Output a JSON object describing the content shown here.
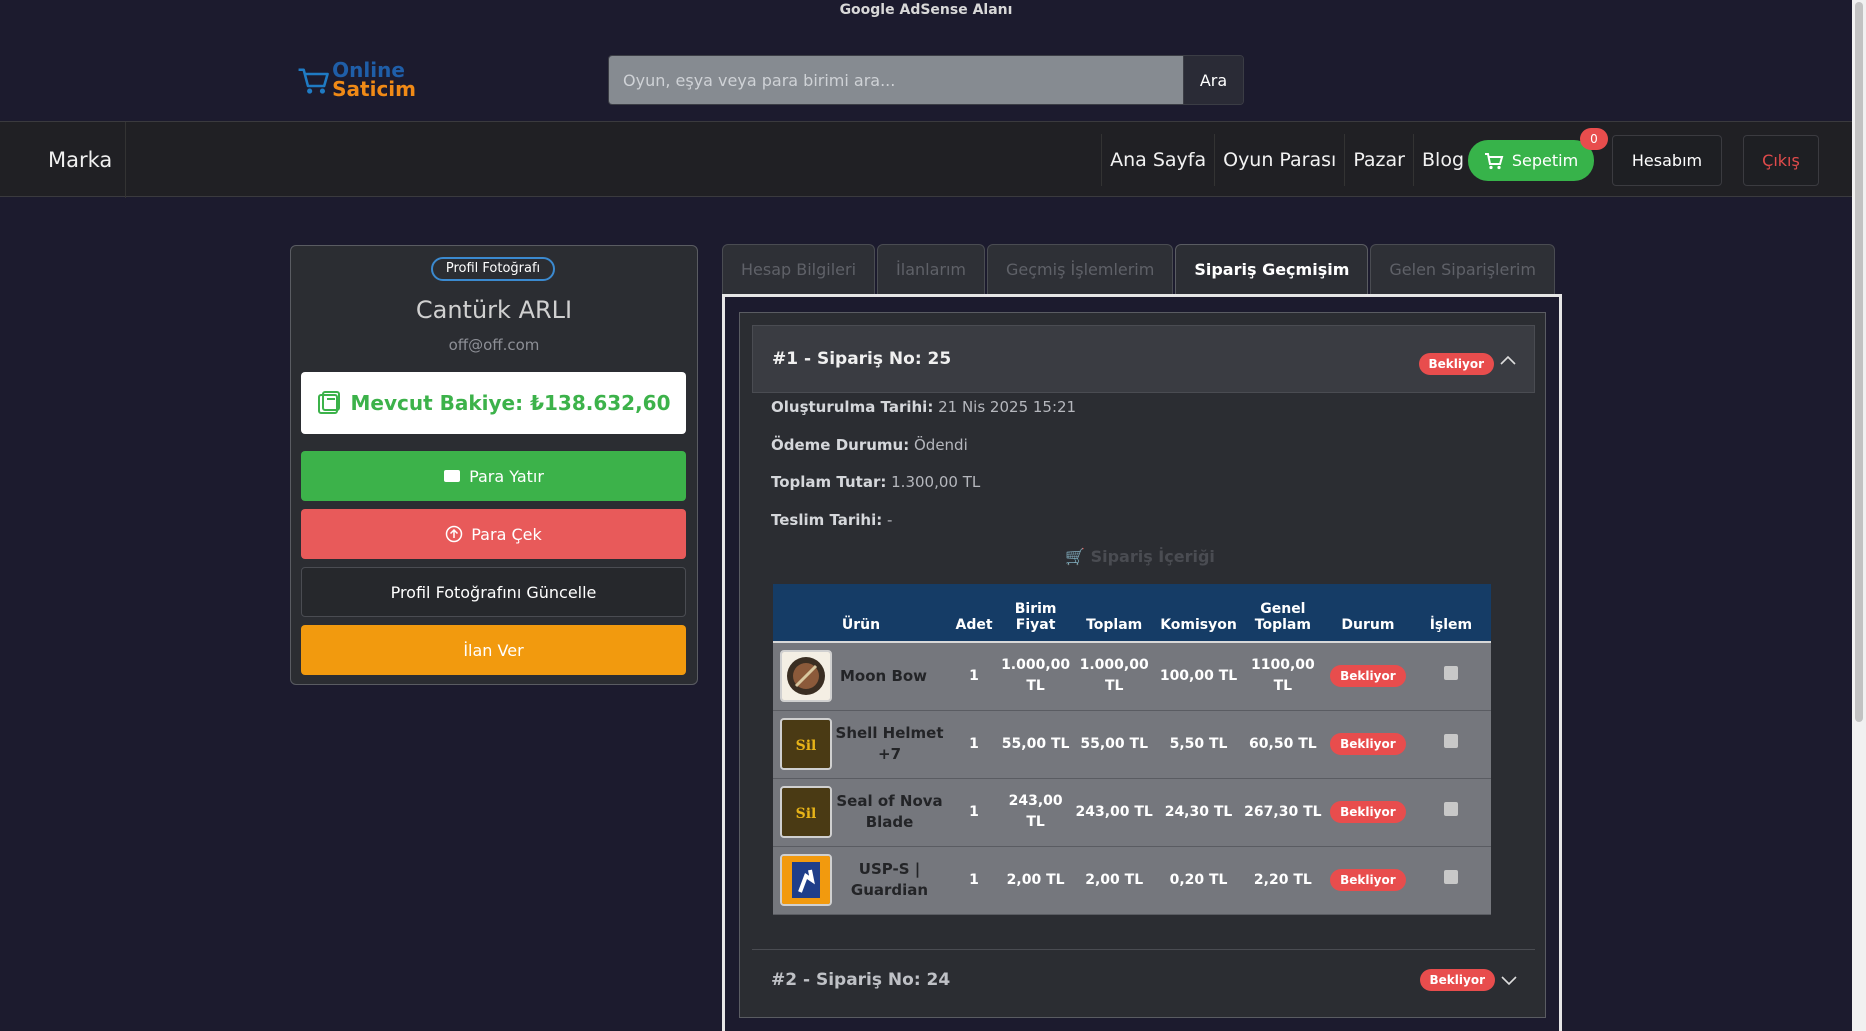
{
  "adsense_label": "Google AdSense Alanı",
  "logo": {
    "line1": "Online",
    "line2": "Saticim"
  },
  "search": {
    "placeholder": "Oyun, eşya veya para birimi ara...",
    "button": "Ara"
  },
  "navbar": {
    "brand": "Marka",
    "links": [
      "Ana Sayfa",
      "Oyun Parası",
      "Pazar",
      "Blog"
    ],
    "cart_label": "Sepetim",
    "cart_count": "0",
    "account": "Hesabım",
    "logout": "Çıkış"
  },
  "profile": {
    "photo_alt": "Profil Fotoğrafı",
    "name": "Cantürk ARLI",
    "email": "off@off.com",
    "balance": "Mevcut Bakiye: ₺138.632,60",
    "deposit": "Para Yatır",
    "withdraw": "Para Çek",
    "update_photo": "Profil Fotoğrafını Güncelle",
    "post_listing": "İlan Ver"
  },
  "tabs": [
    "Hesap Bilgileri",
    "İlanlarım",
    "Geçmiş İşlemlerim",
    "Sipariş Geçmişim",
    "Gelen Siparişlerim"
  ],
  "active_tab": "Sipariş Geçmişim",
  "orders": [
    {
      "title": "#1 - Sipariş No: 25",
      "status": "Bekliyor",
      "created_label": "Oluşturulma Tarihi:",
      "created": "21 Nis 2025 15:21",
      "payment_label": "Ödeme Durumu:",
      "payment": "Ödendi",
      "total_label": "Toplam Tutar:",
      "total": "1.300,00 TL",
      "delivery_label": "Teslim Tarihi:",
      "delivery": "-",
      "contents_title": "🛒 Sipariş İçeriği",
      "table_headers": [
        "Ürün",
        "Adet",
        "Birim Fiyat",
        "Toplam",
        "Komisyon",
        "Genel Toplam",
        "Durum",
        "İşlem"
      ],
      "items": [
        {
          "name": "Moon Bow",
          "qty": "1",
          "unit": "1.000,00 TL",
          "total": "1.000,00 TL",
          "commission": "100,00 TL",
          "grand": "1100,00 TL",
          "status": "Bekliyor",
          "thumb": "bow-icon"
        },
        {
          "name": "Shell Helmet +7",
          "qty": "1",
          "unit": "55,00 TL",
          "total": "55,00 TL",
          "commission": "5,50 TL",
          "grand": "60,50 TL",
          "status": "Bekliyor",
          "thumb": "game-logo-icon"
        },
        {
          "name": "Seal of Nova Blade",
          "qty": "1",
          "unit": "243,00 TL",
          "total": "243,00 TL",
          "commission": "24,30 TL",
          "grand": "267,30 TL",
          "status": "Bekliyor",
          "thumb": "game-logo-icon"
        },
        {
          "name": "USP-S | Guardian",
          "qty": "1",
          "unit": "2,00 TL",
          "total": "2,00 TL",
          "commission": "0,20 TL",
          "grand": "2,20 TL",
          "status": "Bekliyor",
          "thumb": "cs-logo-icon"
        }
      ]
    },
    {
      "title": "#2 - Sipariş No: 24",
      "status": "Bekliyor"
    }
  ],
  "colors": {
    "accent_green": "#3cb24a",
    "danger_red": "#e85a5a",
    "warning_orange": "#f29a0e",
    "table_header": "#153c66"
  }
}
